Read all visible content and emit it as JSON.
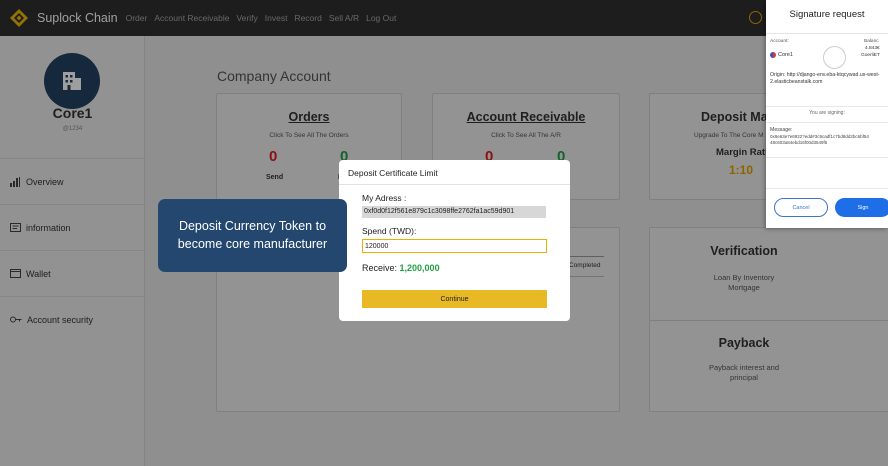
{
  "nav": {
    "brand": "Suplock Chain",
    "links": [
      "Order",
      "Account Receivable",
      "Verify",
      "Invest",
      "Record",
      "Sell A/R",
      "Log Out"
    ]
  },
  "sidebar": {
    "user_name": "Core1",
    "user_id": "@1234",
    "items": [
      {
        "label": "Overview",
        "icon": "bar-chart-icon"
      },
      {
        "label": "information",
        "icon": "id-card-icon"
      },
      {
        "label": "Wallet",
        "icon": "wallet-icon"
      },
      {
        "label": "Account security",
        "icon": "key-icon"
      }
    ]
  },
  "main": {
    "title": "Company Account",
    "orders": {
      "title": "Orders",
      "subtitle": "Click To See All The Orders",
      "send_value": "0",
      "send_label": "Send",
      "second_value": "0",
      "second_label": "Re"
    },
    "ar": {
      "title": "Account Receivable",
      "subtitle": "Click To See All The A/R",
      "first_value": "0",
      "second_value": "0",
      "second_label": "ve"
    },
    "deposit": {
      "title": "Deposit Ma",
      "subtitle": "Upgrade To The Core M",
      "margin_label": "Margin Rati",
      "margin_value": "1:10"
    },
    "record": {
      "status": "Completed"
    },
    "verification": {
      "title": "Verification",
      "desc1": "Loan By Inventory",
      "desc2": "Mortgage"
    },
    "payback": {
      "title": "Payback",
      "desc1": "Payback interest and",
      "desc2": "principal"
    }
  },
  "modal": {
    "title": "Deposit Certificate Limit",
    "address_label": "My Adress :",
    "address_value": "0xf0d0f12f561e879c1c3098ffe2762fa1ac59d901",
    "spend_label": "Spend (TWD):",
    "spend_value": "120000",
    "receive_label": "Receive:",
    "receive_value": "1,200,000",
    "continue_label": "Continue"
  },
  "callout": {
    "line1": "Deposit Currency Token to",
    "line2": "become core manufacturer"
  },
  "signature": {
    "title": "Signature request",
    "account_label": "Account:",
    "account_name": "Core1",
    "balance_label": "Balanc",
    "balance_value": "4.843€",
    "balance_unit": "GoerliET",
    "origin_label": "Origin:",
    "origin_value": "http://django-env.eba-ktqcywad.us-west-2.elasticbeanstalk.com",
    "signing_text": "You are signing:",
    "message_label": "Message:",
    "message_line1": "0x8e63e7e6922?edd#3c9cadf1c7bd8dd2bc6bf54",
    "message_line2": "48c603a84ebd16f00d3549f6",
    "cancel_label": "Cancel",
    "sign_label": "Sign"
  },
  "colors": {
    "accent_yellow": "#e8b825",
    "receive_green": "#21a043",
    "callout_blue": "#23476f",
    "sign_blue": "#1e6ee8",
    "red_value": "#e02020",
    "green_value": "#21a043",
    "margin_orange": "#e4a000"
  }
}
